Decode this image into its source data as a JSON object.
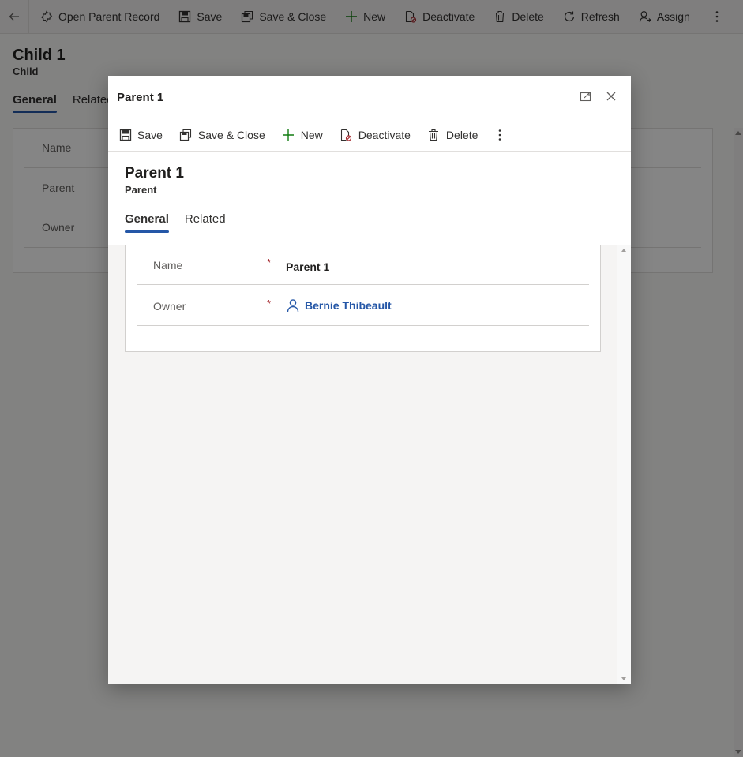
{
  "background": {
    "commands": [
      {
        "label": "Open Parent Record",
        "icon": "open-record-icon"
      },
      {
        "label": "Save",
        "icon": "save-icon"
      },
      {
        "label": "Save & Close",
        "icon": "save-close-icon"
      },
      {
        "label": "New",
        "icon": "plus-icon"
      },
      {
        "label": "Deactivate",
        "icon": "deactivate-icon"
      },
      {
        "label": "Delete",
        "icon": "trash-icon"
      },
      {
        "label": "Refresh",
        "icon": "refresh-icon"
      },
      {
        "label": "Assign",
        "icon": "assign-icon"
      }
    ],
    "record_title": "Child 1",
    "entity_name": "Child",
    "tabs": [
      "General",
      "Related"
    ],
    "fields": [
      "Name",
      "Parent",
      "Owner"
    ]
  },
  "dialog": {
    "title": "Parent 1",
    "commands": [
      {
        "label": "Save",
        "icon": "save-icon"
      },
      {
        "label": "Save & Close",
        "icon": "save-close-icon"
      },
      {
        "label": "New",
        "icon": "plus-icon"
      },
      {
        "label": "Deactivate",
        "icon": "deactivate-icon"
      },
      {
        "label": "Delete",
        "icon": "trash-icon"
      }
    ],
    "record_title": "Parent 1",
    "entity_name": "Parent",
    "tabs": [
      "General",
      "Related"
    ],
    "active_tab": "General",
    "fields": [
      {
        "label": "Name",
        "required_mark": "*",
        "value": "Parent 1"
      },
      {
        "label": "Owner",
        "required_mark": "*",
        "value": "Bernie Thibeault"
      }
    ]
  },
  "colors": {
    "accent": "#2557a7",
    "required": "#a4262c",
    "link": "#2557a7",
    "plus_green": "#107c10"
  }
}
